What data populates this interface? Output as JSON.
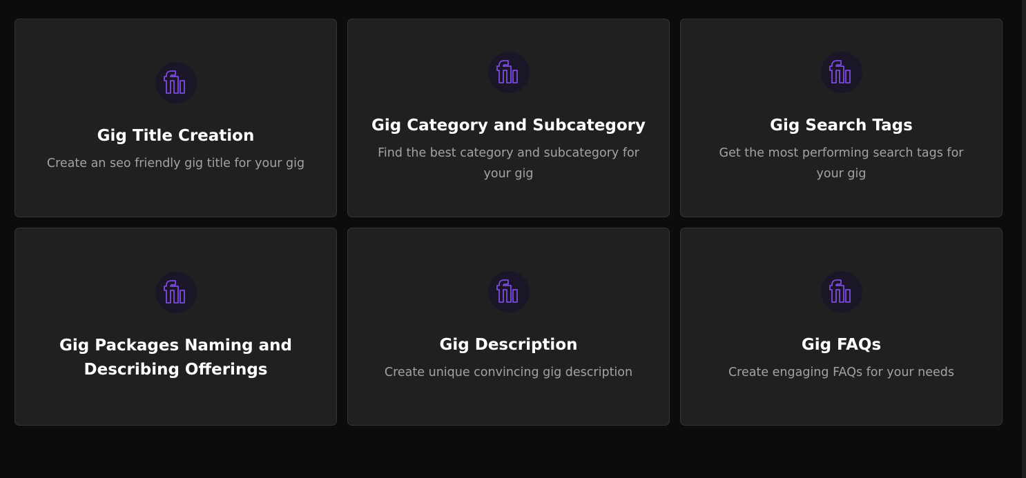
{
  "theme": {
    "background": "#0c0c0c",
    "card_background": "#202020",
    "card_border": "#343434",
    "accent": "#7c4be0",
    "icon_circle": "#1a1627",
    "title_color": "#ffffff",
    "description_color": "#a3a3a3"
  },
  "cards": [
    {
      "icon": "fiverr-logo-icon",
      "title": "Gig Title Creation",
      "description": "Create an seo friendly gig title for your gig"
    },
    {
      "icon": "fiverr-logo-icon",
      "title": "Gig Category and Subcategory",
      "description": "Find the best category and subcategory for your gig"
    },
    {
      "icon": "fiverr-logo-icon",
      "title": "Gig Search Tags",
      "description": "Get the most performing search tags for your gig"
    },
    {
      "icon": "fiverr-logo-icon",
      "title": "Gig Packages Naming and Describing Offerings",
      "description": ""
    },
    {
      "icon": "fiverr-logo-icon",
      "title": "Gig Description",
      "description": "Create unique convincing gig description"
    },
    {
      "icon": "fiverr-logo-icon",
      "title": "Gig FAQs",
      "description": "Create engaging FAQs for your needs"
    }
  ]
}
